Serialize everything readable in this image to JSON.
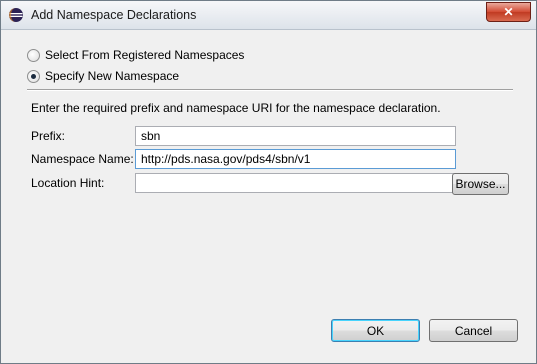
{
  "window": {
    "title": "Add Namespace Declarations",
    "title_icon": "eclipse-icon",
    "close_label": "✕"
  },
  "options": {
    "registered_label": "Select From Registered Namespaces",
    "specify_label": "Specify New Namespace",
    "selected": "specify"
  },
  "instruction": "Enter the required prefix and namespace URI for the namespace declaration.",
  "fields": {
    "prefix": {
      "label": "Prefix:",
      "value": "sbn"
    },
    "namespace_name": {
      "label": "Namespace Name:",
      "value": "http://pds.nasa.gov/pds4/sbn/v1"
    },
    "location_hint": {
      "label": "Location Hint:",
      "value": ""
    }
  },
  "buttons": {
    "browse": "Browse...",
    "ok": "OK",
    "cancel": "Cancel"
  }
}
